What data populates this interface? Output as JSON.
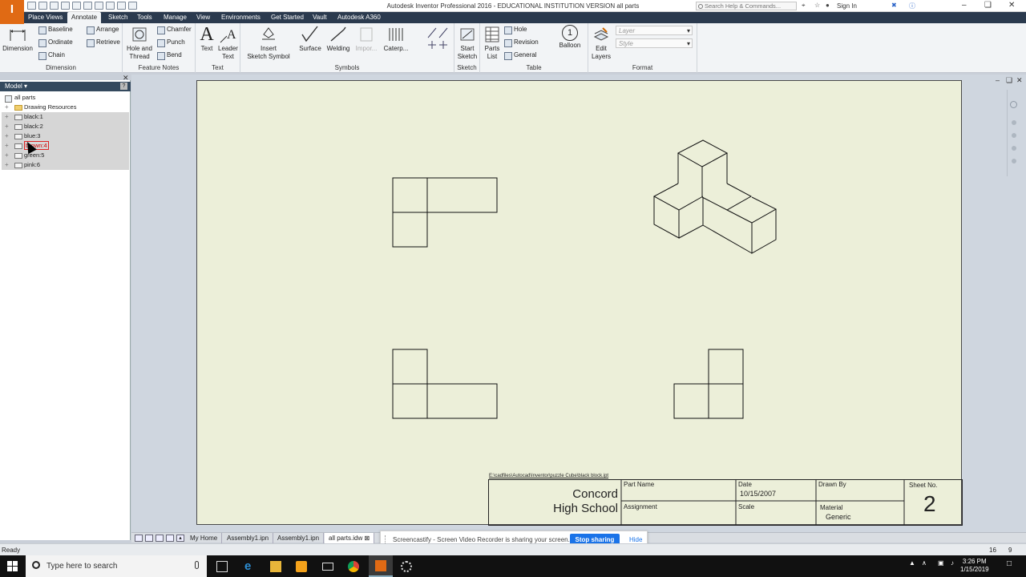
{
  "window": {
    "title": "Autodesk Inventor Professional 2016 - EDUCATIONAL INSTITUTION VERSION    all parts",
    "app_button_label": "I",
    "app_button_sub": "PRO",
    "help_placeholder": "Search Help & Commands...",
    "signin_label": "Sign In"
  },
  "menu_tabs": [
    "Place Views",
    "Annotate",
    "Sketch",
    "Tools",
    "Manage",
    "View",
    "Environments",
    "Get Started",
    "Vault",
    "Autodesk A360"
  ],
  "ribbon": {
    "dimension": {
      "group": "Dimension",
      "big": "Dimension",
      "baseline": "Baseline",
      "ordinate": "Ordinate",
      "chain": "Chain",
      "arrange": "Arrange",
      "retrieve": "Retrieve"
    },
    "feature_notes": {
      "group": "Feature Notes",
      "hole_thread_1": "Hole and",
      "hole_thread_2": "Thread",
      "chamfer": "Chamfer",
      "punch": "Punch",
      "bend": "Bend"
    },
    "text": {
      "group": "Text",
      "text": "Text",
      "leader_1": "Leader",
      "leader_2": "Text"
    },
    "symbols": {
      "group": "Symbols",
      "insert_1": "Insert",
      "insert_2": "Sketch Symbol",
      "surface": "Surface",
      "welding": "Welding",
      "import": "Impor...",
      "caterpillar": "Caterp..."
    },
    "sketch": {
      "group": "Sketch",
      "start_1": "Start",
      "start_2": "Sketch"
    },
    "table": {
      "group": "Table",
      "parts_1": "Parts",
      "parts_2": "List",
      "hole": "Hole",
      "revision": "Revision",
      "general": "General",
      "balloon": "Balloon",
      "balloon_num": "1"
    },
    "format": {
      "group": "Format",
      "edit_1": "Edit",
      "edit_2": "Layers",
      "layer_placeholder": "Layer",
      "style_placeholder": "Style"
    }
  },
  "browser": {
    "header": "Model",
    "items": [
      {
        "label": "all parts",
        "type": "root"
      },
      {
        "label": "Drawing Resources",
        "type": "folder"
      },
      {
        "label": "black:1",
        "type": "part",
        "selected": true
      },
      {
        "label": "black:2",
        "type": "part",
        "selected": true
      },
      {
        "label": "blue:3",
        "type": "part",
        "selected": true
      },
      {
        "label": "brown:4",
        "type": "part",
        "selected": true,
        "highlight": true
      },
      {
        "label": "green:5",
        "type": "part",
        "selected": true
      },
      {
        "label": "pink:6",
        "type": "part",
        "selected": true
      }
    ]
  },
  "title_block": {
    "file_path": "E:\\cadfiles\\Autocad\\Inventor\\puzzle Cube\\black block.ipt",
    "school_1": "Concord",
    "school_2": "High School",
    "part_name_label": "Part Name",
    "assignment_label": "Assignment",
    "date_label": "Date",
    "date_value": "10/15/2007",
    "scale_label": "Scale",
    "drawn_by_label": "Drawn By",
    "material_label": "Material",
    "material_value": "Generic",
    "sheet_no_label": "Sheet No.",
    "sheet_no_value": "2"
  },
  "bottom_tabs": [
    "My Home",
    "Assembly1.ipn",
    "Assembly1.ipn",
    "all parts.idw"
  ],
  "screencast": {
    "message": "Screencastify - Screen Video Recorder is sharing your screen.",
    "stop_label": "Stop sharing",
    "hide_label": "Hide"
  },
  "status": {
    "text": "Ready",
    "count_a": "16",
    "count_b": "9"
  },
  "taskbar": {
    "search_placeholder": "Type here to search",
    "time": "3:26 PM",
    "date": "1/15/2019"
  },
  "colors": {
    "app_orange": "#e06a14",
    "tab_bar": "#2b3a4e",
    "sheet": "#ecefd9",
    "stop_button": "#1a73e8"
  }
}
